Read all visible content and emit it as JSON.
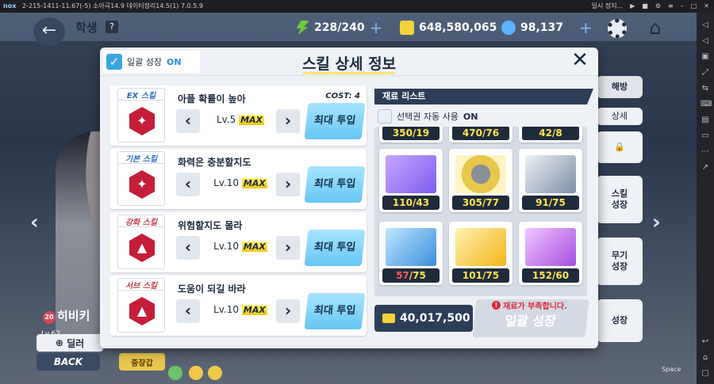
{
  "emulator": {
    "logo": "nox",
    "title": "2-215-1411-11.67(-5) 소아곡14.9 데이터정리14.5(1) 7.0.5.9",
    "pause_label": "일시 정지...",
    "space_label": "Space"
  },
  "hud": {
    "title": "학생",
    "help": "?",
    "ap": "228/240",
    "credits": "648,580,065",
    "gems": "98,137"
  },
  "right_menu": {
    "tab": "해방",
    "detail": "상세",
    "skill_grow": "스킬\n성장",
    "weapon_grow": "무기\n성장",
    "grow": "성장"
  },
  "character": {
    "level_badge": "20",
    "name": "히비키",
    "lv": "Lv.62",
    "dealer": "딜러",
    "back": "BACK",
    "armor": "중장갑"
  },
  "modal": {
    "auto_grow_label": "일괄 성장",
    "auto_grow_state": "ON",
    "title": "스킬 상세 정보",
    "close": "✕",
    "skills": [
      {
        "tag": "EX 스킬",
        "name": "아플 확률이 높아",
        "cost": "COST: 4",
        "level": "Lv.5",
        "max": "MAX",
        "button": "최대 투입",
        "prev": "‹",
        "next": "›"
      },
      {
        "tag": "기본 스킬",
        "name": "화력은 충분할지도",
        "cost": "",
        "level": "Lv.10",
        "max": "MAX",
        "button": "최대 투입",
        "prev": "‹",
        "next": "›"
      },
      {
        "tag": "강화 스킬",
        "name": "위험할지도 몰라",
        "cost": "",
        "level": "Lv.10",
        "max": "MAX",
        "button": "최대 투입",
        "prev": "‹",
        "next": "›"
      },
      {
        "tag": "서브 스킬",
        "name": "도움이 되길 바라",
        "cost": "",
        "level": "Lv.10",
        "max": "MAX",
        "button": "최대 투입",
        "prev": "‹",
        "next": "›"
      }
    ],
    "materials_header": "재료 리스트",
    "ticket_label": "선택권 자동 사용",
    "ticket_state": "ON",
    "materials_top": [
      "350/19",
      "470/76",
      "42/8"
    ],
    "materials": [
      {
        "have": "110",
        "need": "/43",
        "short": false
      },
      {
        "have": "305",
        "need": "/77",
        "short": false
      },
      {
        "have": "91",
        "need": "/75",
        "short": false
      },
      {
        "have": "57",
        "need": "/75",
        "short": true
      },
      {
        "have": "101",
        "need": "/75",
        "short": false
      },
      {
        "have": "152",
        "need": "/60",
        "short": false
      }
    ],
    "credit_cost": "40,017,500",
    "warning": "재료가 부족합니다.",
    "bulk_button": "일괄 성장"
  },
  "colors": {
    "accent": "#66c7f3",
    "skill_red": "#c41e3a",
    "warning": "#e0283d"
  }
}
